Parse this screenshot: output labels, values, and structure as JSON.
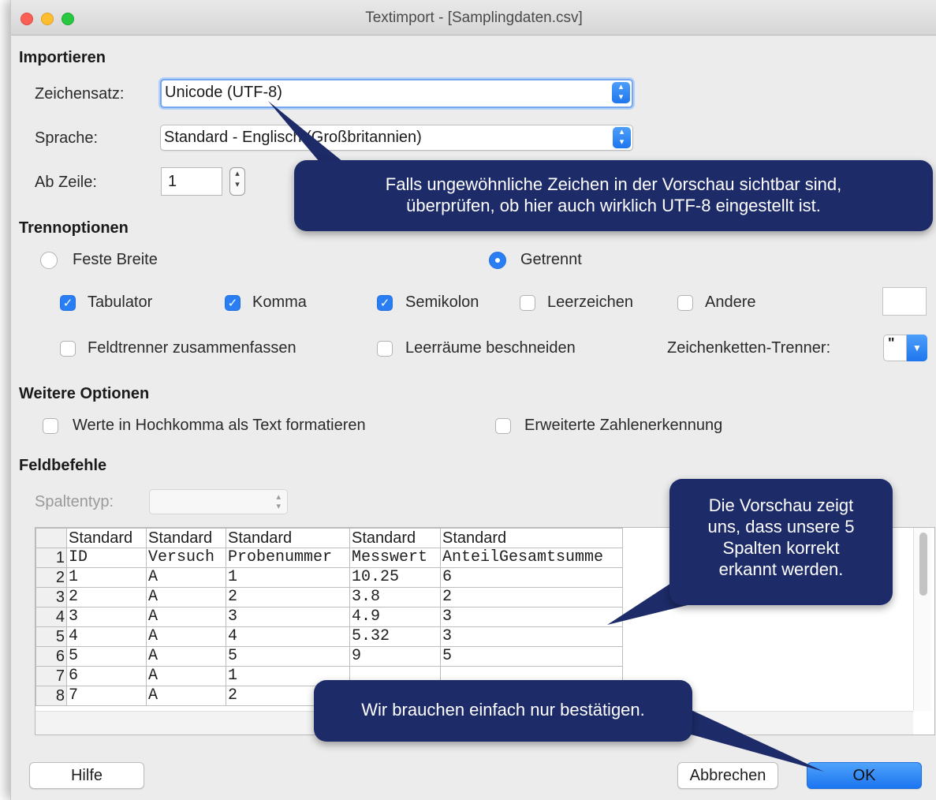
{
  "window": {
    "title": "Textimport - [Samplingdaten.csv]"
  },
  "importieren": {
    "heading": "Importieren",
    "charset_label": "Zeichensatz:",
    "charset_value": "Unicode (UTF-8)",
    "language_label": "Sprache:",
    "language_value": "Standard - Englisch (Großbritannien)",
    "from_row_label": "Ab Zeile:",
    "from_row_value": "1"
  },
  "trennoptionen": {
    "heading": "Trennoptionen",
    "fixed_width_label": "Feste Breite",
    "fixed_width_selected": false,
    "separated_label": "Getrennt",
    "separated_selected": true,
    "tab_label": "Tabulator",
    "tab_checked": true,
    "comma_label": "Komma",
    "comma_checked": true,
    "semicolon_label": "Semikolon",
    "semicolon_checked": true,
    "space_label": "Leerzeichen",
    "space_checked": false,
    "other_label": "Andere",
    "other_checked": false,
    "merge_label": "Feldtrenner zusammenfassen",
    "merge_checked": false,
    "trim_label": "Leerräume beschneiden",
    "trim_checked": false,
    "string_delim_label": "Zeichenketten-Trenner:",
    "string_delim_value": "\""
  },
  "weitere": {
    "heading": "Weitere Optionen",
    "quoted_label": "Werte in Hochkomma als Text formatieren",
    "quoted_checked": false,
    "numbers_label": "Erweiterte Zahlenerkennung",
    "numbers_checked": false
  },
  "feldbefehle": {
    "heading": "Feldbefehle",
    "column_type_label": "Spaltentyp:"
  },
  "preview": {
    "column_types": [
      "Standard",
      "Standard",
      "Standard",
      "Standard",
      "Standard"
    ],
    "rows": [
      {
        "num": "1",
        "cells": [
          "ID",
          "Versuch",
          "Probenummer",
          "Messwert",
          "AnteilGesamtsumme"
        ]
      },
      {
        "num": "2",
        "cells": [
          "1",
          "A",
          "1",
          "10.25",
          "6"
        ]
      },
      {
        "num": "3",
        "cells": [
          "2",
          "A",
          "2",
          "3.8",
          "2"
        ]
      },
      {
        "num": "4",
        "cells": [
          "3",
          "A",
          "3",
          "4.9",
          "3"
        ]
      },
      {
        "num": "5",
        "cells": [
          "4",
          "A",
          "4",
          "5.32",
          "3"
        ]
      },
      {
        "num": "6",
        "cells": [
          "5",
          "A",
          "5",
          "9",
          "5"
        ]
      },
      {
        "num": "7",
        "cells": [
          "6",
          "A",
          "1",
          "",
          ""
        ]
      },
      {
        "num": "8",
        "cells": [
          "7",
          "A",
          "2",
          "",
          ""
        ]
      }
    ]
  },
  "buttons": {
    "help": "Hilfe",
    "cancel": "Abbrechen",
    "ok": "OK"
  },
  "callouts": {
    "charset_line1": "Falls ungewöhnliche Zeichen in der Vorschau sichtbar sind,",
    "charset_line2": "überprüfen, ob hier auch wirklich UTF-8 eingestellt ist.",
    "preview_line1": "Die Vorschau zeigt",
    "preview_line2": "uns, dass unsere 5",
    "preview_line3": "Spalten korrekt",
    "preview_line4": "erkannt werden.",
    "ok": "Wir brauchen einfach nur bestätigen."
  },
  "colors": {
    "accent": "#2a7ef3",
    "callout": "#1d2b69",
    "dialog_bg": "#ececec"
  }
}
